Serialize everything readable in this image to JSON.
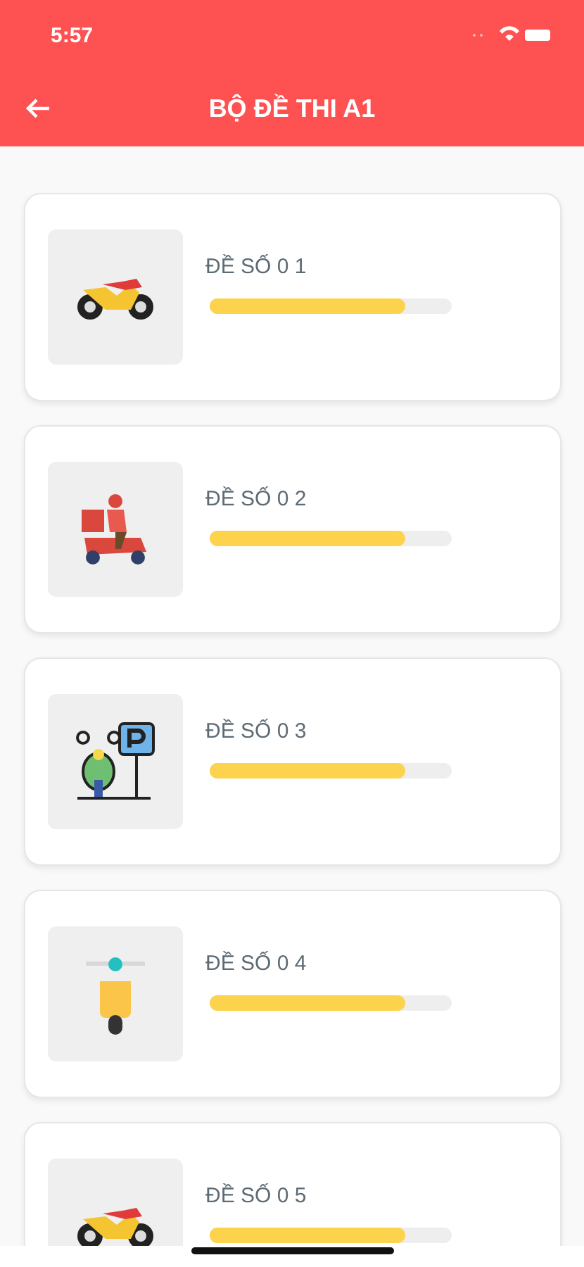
{
  "status_bar": {
    "time": "5:57"
  },
  "header": {
    "title": "BỘ ĐỀ THI A1"
  },
  "tests": [
    {
      "title": "ĐỀ SỐ 0 1",
      "level": 0.81
    },
    {
      "title": "ĐỀ SỐ 0 2",
      "level": 0.81
    },
    {
      "title": "ĐỀ SỐ 0 3",
      "level": 0.81
    },
    {
      "title": "ĐỀ SỐ 0 4",
      "level": 0.81
    },
    {
      "title": "ĐỀ SỐ 0 5",
      "level": 0.81
    }
  ]
}
